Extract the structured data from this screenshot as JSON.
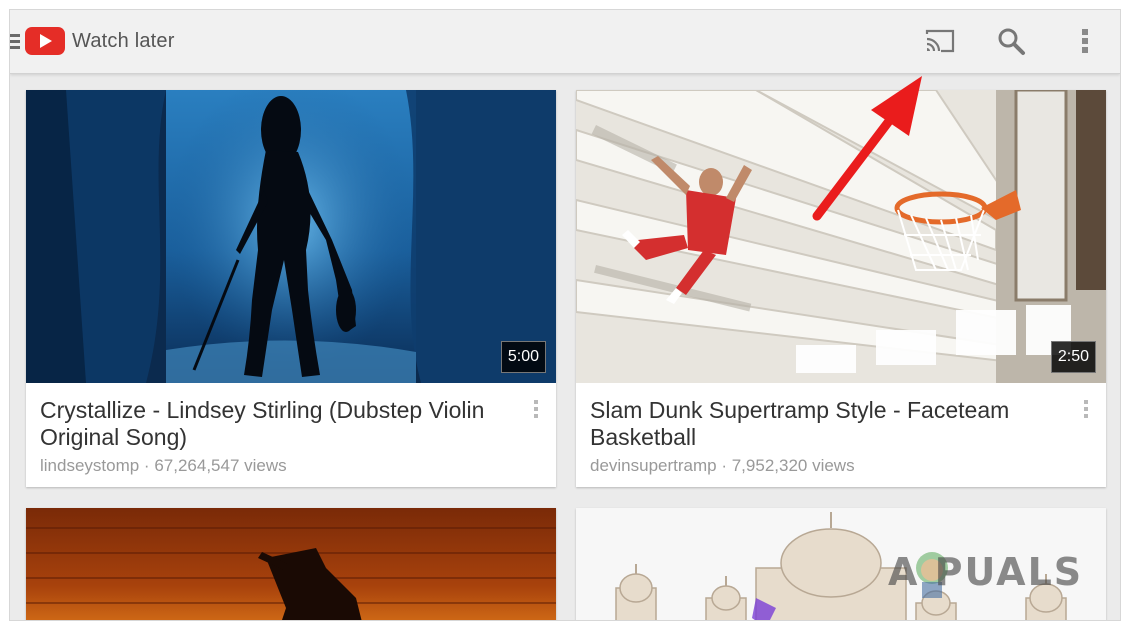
{
  "app": {
    "title": "Watch later",
    "icons": {
      "nav": "hamburger-menu-icon",
      "logo": "youtube-logo",
      "cast": "cast-icon",
      "search": "search-icon",
      "more": "more-vert-icon"
    },
    "colors": {
      "brand_red": "#e52d27",
      "arrow_red": "#ea1c1c"
    }
  },
  "videos": [
    {
      "title": "Crystallize - Lindsey Stirling (Dubstep Violin Original Song)",
      "channel": "lindseystomp",
      "views": "67,264,547 views",
      "meta": "lindseystomp · 67,264,547 views",
      "duration": "5:00"
    },
    {
      "title": "Slam Dunk Supertramp Style - Faceteam Basketball",
      "channel": "devinsupertramp",
      "views": "7,952,320 views",
      "meta": "devinsupertramp · 7,952,320 views",
      "duration": "2:50"
    },
    {
      "title": "",
      "channel": "",
      "views": "",
      "meta": "",
      "duration": ""
    },
    {
      "title": "",
      "channel": "",
      "views": "",
      "meta": "",
      "duration": ""
    }
  ],
  "watermark": {
    "text": "A  PUALS"
  }
}
